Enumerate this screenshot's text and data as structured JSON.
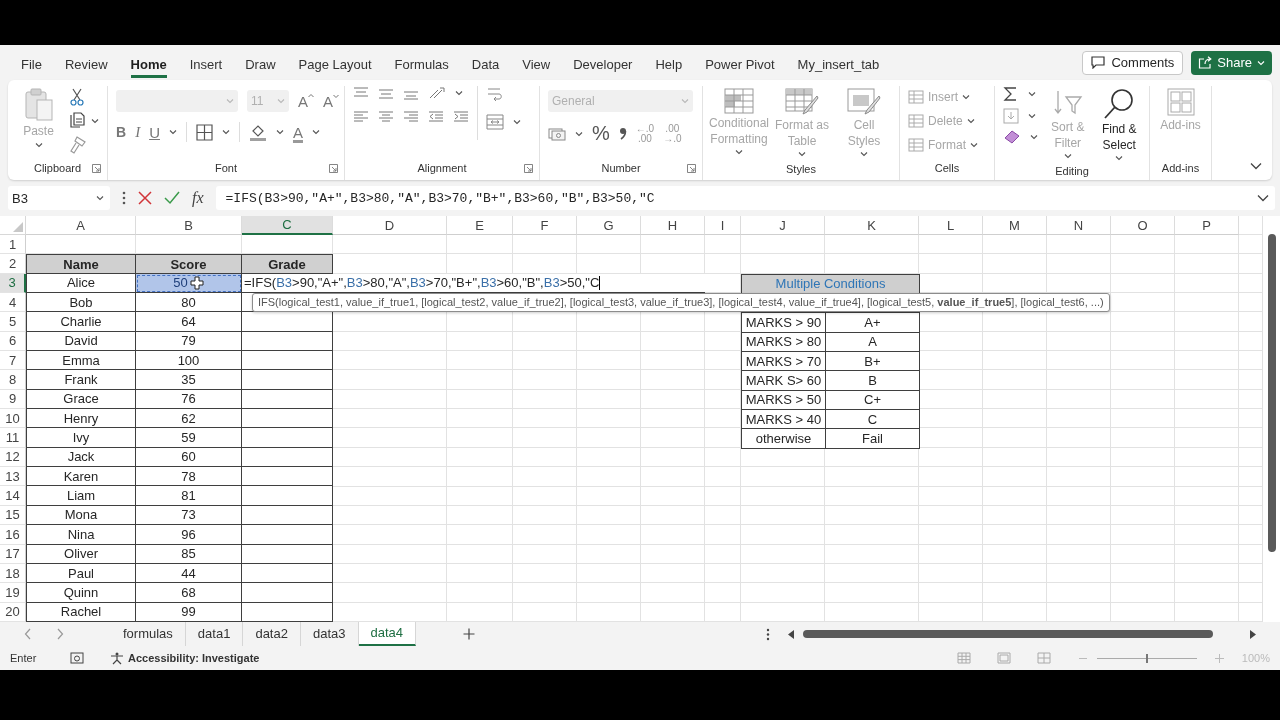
{
  "menu": {
    "tabs": [
      {
        "label": "File",
        "selected": false
      },
      {
        "label": "Review",
        "selected": false
      },
      {
        "label": "Home",
        "selected": true
      },
      {
        "label": "Insert",
        "selected": false
      },
      {
        "label": "Draw",
        "selected": false
      },
      {
        "label": "Page Layout",
        "selected": false
      },
      {
        "label": "Formulas",
        "selected": false
      },
      {
        "label": "Data",
        "selected": false
      },
      {
        "label": "View",
        "selected": false
      },
      {
        "label": "Developer",
        "selected": false
      },
      {
        "label": "Help",
        "selected": false
      },
      {
        "label": "Power Pivot",
        "selected": false
      },
      {
        "label": "My_insert_tab",
        "selected": false
      }
    ],
    "comments": "Comments",
    "share": "Share"
  },
  "ribbon": {
    "clipboard": {
      "label": "Clipboard",
      "paste": {
        "label": "Paste",
        "disabled": true
      }
    },
    "font": {
      "label": "Font",
      "size": "11",
      "size_buttons": [
        "A",
        "A"
      ],
      "style_buttons": [
        "B",
        "I",
        "U"
      ],
      "color_letter": "A"
    },
    "alignment": {
      "label": "Alignment"
    },
    "number": {
      "label": "Number",
      "format": "General",
      "percent": "%",
      "decimals": [
        {
          "top": "←.0",
          "bottom": ".00"
        },
        {
          "top": ".00",
          "bottom": "→.0"
        }
      ]
    },
    "styles": {
      "label": "Styles",
      "buttons": [
        {
          "label": "Conditional Formatting",
          "disabled": true
        },
        {
          "label": "Format as Table",
          "disabled": true
        },
        {
          "label": "Cell Styles",
          "disabled": true
        }
      ]
    },
    "cells": {
      "label": "Cells",
      "buttons": [
        {
          "label": "Insert",
          "disabled": true
        },
        {
          "label": "Delete",
          "disabled": true
        },
        {
          "label": "Format",
          "disabled": true
        }
      ]
    },
    "editing": {
      "label": "Editing",
      "buttons": [
        {
          "label": "Sort & Filter",
          "disabled": true
        },
        {
          "label": "Find & Select",
          "disabled": false
        }
      ]
    },
    "addins": {
      "label": "Add-ins",
      "buttons": [
        {
          "label": "Add-ins",
          "disabled": true
        }
      ]
    }
  },
  "formula_bar": {
    "name_box": "B3",
    "fx": "fx",
    "formula": "=IFS(B3>90,\"A+\",B3>80,\"A\",B3>70,\"B+\",B3>60,\"B\",B3>50,\"C"
  },
  "sheet": {
    "columns": [
      {
        "label": "A",
        "selected": false
      },
      {
        "label": "B",
        "selected": false
      },
      {
        "label": "C",
        "selected": true
      },
      {
        "label": "D",
        "selected": false
      },
      {
        "label": "E",
        "selected": false
      },
      {
        "label": "F",
        "selected": false
      },
      {
        "label": "G",
        "selected": false
      },
      {
        "label": "H",
        "selected": false
      },
      {
        "label": "I",
        "selected": false
      },
      {
        "label": "J",
        "selected": false
      },
      {
        "label": "K",
        "selected": false
      },
      {
        "label": "L",
        "selected": false
      },
      {
        "label": "M",
        "selected": false
      },
      {
        "label": "N",
        "selected": false
      },
      {
        "label": "O",
        "selected": false
      },
      {
        "label": "P",
        "selected": false
      }
    ],
    "rows": [
      {
        "label": "1",
        "selected": false
      },
      {
        "label": "2",
        "selected": false
      },
      {
        "label": "3",
        "selected": true
      },
      {
        "label": "4",
        "selected": false
      },
      {
        "label": "5",
        "selected": false
      },
      {
        "label": "6",
        "selected": false
      },
      {
        "label": "7",
        "selected": false
      },
      {
        "label": "8",
        "selected": false
      },
      {
        "label": "9",
        "selected": false
      },
      {
        "label": "10",
        "selected": false
      },
      {
        "label": "11",
        "selected": false
      },
      {
        "label": "12",
        "selected": false
      },
      {
        "label": "13",
        "selected": false
      },
      {
        "label": "14",
        "selected": false
      },
      {
        "label": "15",
        "selected": false
      },
      {
        "label": "16",
        "selected": false
      },
      {
        "label": "17",
        "selected": false
      },
      {
        "label": "18",
        "selected": false
      },
      {
        "label": "19",
        "selected": false
      },
      {
        "label": "20",
        "selected": false
      }
    ],
    "grade_table": {
      "headers": [
        "Name",
        "Score",
        "Grade"
      ],
      "rows": [
        {
          "name": "Alice",
          "score": "50",
          "selected": true
        },
        {
          "name": "Bob",
          "score": "80",
          "selected": false
        },
        {
          "name": "Charlie",
          "score": "64",
          "selected": false
        },
        {
          "name": "David",
          "score": "79",
          "selected": false
        },
        {
          "name": "Emma",
          "score": "100",
          "selected": false
        },
        {
          "name": "Frank",
          "score": "35",
          "selected": false
        },
        {
          "name": "Grace",
          "score": "76",
          "selected": false
        },
        {
          "name": "Henry",
          "score": "62",
          "selected": false
        },
        {
          "name": "Ivy",
          "score": "59",
          "selected": false
        },
        {
          "name": "Jack",
          "score": "60",
          "selected": false
        },
        {
          "name": "Karen",
          "score": "78",
          "selected": false
        },
        {
          "name": "Liam",
          "score": "81",
          "selected": false
        },
        {
          "name": "Mona",
          "score": "73",
          "selected": false
        },
        {
          "name": "Nina",
          "score": "96",
          "selected": false
        },
        {
          "name": "Oliver",
          "score": "85",
          "selected": false
        },
        {
          "name": "Paul",
          "score": "44",
          "selected": false
        },
        {
          "name": "Quinn",
          "score": "68",
          "selected": false
        },
        {
          "name": "Rachel",
          "score": "99",
          "selected": false
        }
      ]
    },
    "editing_cell": {
      "segments": [
        {
          "kind": "text",
          "text": "=IFS("
        },
        {
          "kind": "ref",
          "text": "B3"
        },
        {
          "kind": "text",
          "text": ">90,\"A+\","
        },
        {
          "kind": "ref",
          "text": "B3"
        },
        {
          "kind": "text",
          "text": ">80,\"A\","
        },
        {
          "kind": "ref",
          "text": "B3"
        },
        {
          "kind": "text",
          "text": ">70,\"B+\","
        },
        {
          "kind": "ref",
          "text": "B3"
        },
        {
          "kind": "text",
          "text": ">60,\"B\","
        },
        {
          "kind": "ref",
          "text": "B3"
        },
        {
          "kind": "text",
          "text": ">50,\"C"
        }
      ]
    },
    "tooltip": "IFS(logical_test1, value_if_true1, [logical_test2, value_if_true2], [logical_test3, value_if_true3], [logical_test4, value_if_true4], [logical_test5, **value_if_true5**], [logical_test6, ...)",
    "conditions": {
      "title": "Multiple Conditions",
      "rows": [
        {
          "condition": "MARKS > 90",
          "grade": "A+"
        },
        {
          "condition": "MARKS > 80",
          "grade": "A"
        },
        {
          "condition": "MARKS > 70",
          "grade": "B+"
        },
        {
          "condition": "MARK S> 60",
          "grade": "B"
        },
        {
          "condition": "MARKS > 50",
          "grade": "C+"
        },
        {
          "condition": "MARKS > 40",
          "grade": "C"
        },
        {
          "condition": "otherwise",
          "grade": "Fail"
        }
      ]
    }
  },
  "sheet_tabs": [
    {
      "label": "formulas",
      "selected": false
    },
    {
      "label": "data1",
      "selected": false
    },
    {
      "label": "data2",
      "selected": false
    },
    {
      "label": "data3",
      "selected": false
    },
    {
      "label": "data4",
      "selected": true
    }
  ],
  "status_bar": {
    "mode": "Enter",
    "accessibility": "Accessibility: Investigate",
    "zoom": "100%",
    "zoom_slider": {
      "level": 0.5
    }
  }
}
